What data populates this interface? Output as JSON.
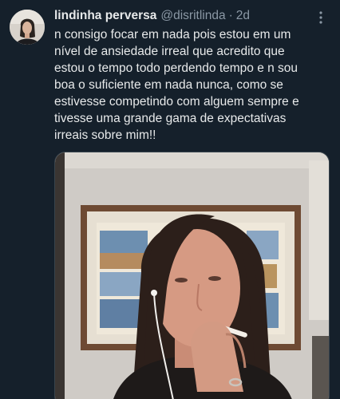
{
  "tweet": {
    "display_name": "lindinha perversa",
    "handle": "@disritlinda",
    "separator": "·",
    "timestamp": "2d",
    "text": "n consigo focar em nada pois estou em um\nnível de ansiedade irreal que acredito que\nestou o tempo todo perdendo tempo e n sou\nboa o suficiente em nada nunca, como se\nestivesse competindo com alguem sempre e\ntivesse uma grande gama de expectativas\nirreais sobre mim!!",
    "more_icon": "more-horizontal-icon",
    "media_type": "photo"
  },
  "colors": {
    "background": "#15202b",
    "primary_text": "#e7e9ea",
    "secondary_text": "#8b98a5",
    "border": "#38444d"
  }
}
